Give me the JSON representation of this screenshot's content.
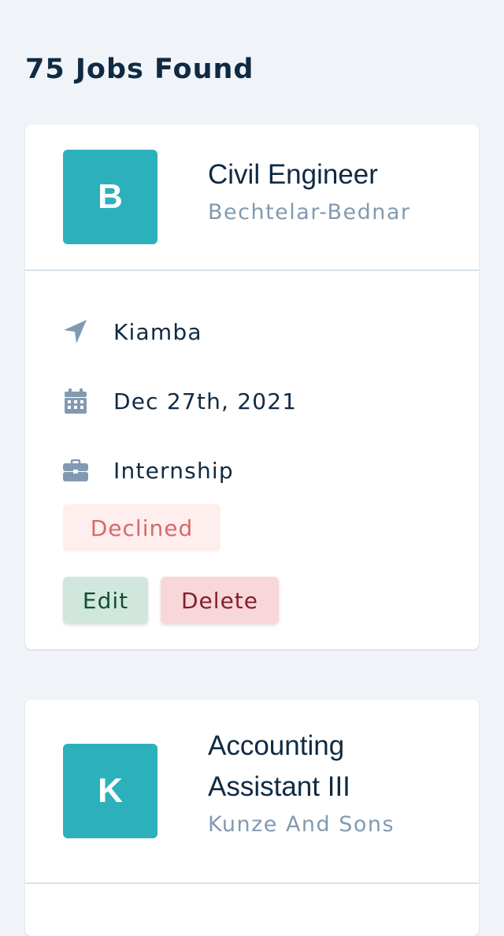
{
  "header": {
    "jobs_found": "75 Jobs Found"
  },
  "colors": {
    "background": "#f0f4f8",
    "logo": "#2cb1bc",
    "text_primary": "#102a43",
    "text_muted": "#829ab1",
    "declined_bg": "#ffeeee",
    "declined_text": "#d66a6a",
    "edit_bg": "#d1e7dd",
    "edit_text": "#0f5132",
    "delete_bg": "#f8d7da",
    "delete_text": "#842029"
  },
  "jobs": [
    {
      "logo_letter": "B",
      "position": "Civil Engineer",
      "company": "Bechtelar-Bednar",
      "location": "Kiamba",
      "date": "Dec 27th, 2021",
      "job_type": "Internship",
      "status": "Declined",
      "edit_label": "Edit",
      "delete_label": "Delete",
      "icons": {
        "location": "location-arrow-icon",
        "date": "calendar-icon",
        "job_type": "briefcase-icon"
      }
    },
    {
      "logo_letter": "K",
      "position": "Accounting Assistant III",
      "company": "Kunze And Sons"
    }
  ]
}
